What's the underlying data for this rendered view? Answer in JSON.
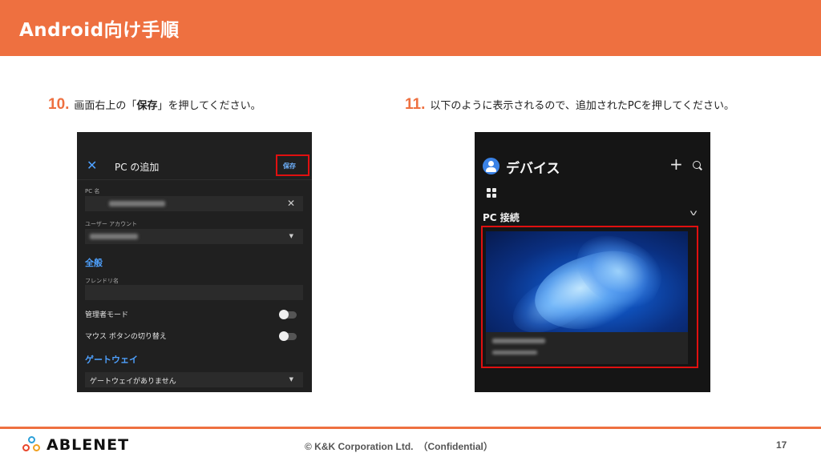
{
  "header": {
    "title": "Android向け手順"
  },
  "step10": {
    "number": "10.",
    "text_pre": "画面右上の「",
    "text_bold": "保存",
    "text_post": "」を押してください。"
  },
  "step11": {
    "number": "11.",
    "text": "以下のように表示されるので、追加されたPCを押してください。"
  },
  "screen1": {
    "close_glyph": "✕",
    "title": "PC の追加",
    "save_label": "保存",
    "pc_name_label": "PC 名",
    "clear_glyph": "✕",
    "user_account_label": "ユーザー アカウント",
    "dropdown_glyph": "▼",
    "section_general": "全般",
    "friendly_name_label": "フレンドリ名",
    "admin_mode_label": "管理者モード",
    "swap_mouse_label": "マウス ボタンの切り替え",
    "section_gateway": "ゲートウェイ",
    "gateway_value": "ゲートウェイがありません"
  },
  "screen2": {
    "title": "デバイス",
    "add_glyph": "+",
    "section_pc": "PC 接続",
    "chevron_glyph": "v"
  },
  "footer": {
    "logo_text": "ABLENET",
    "copyright": "© K&K Corporation Ltd.　（Confidential）",
    "page_number": "17"
  },
  "colors": {
    "accent": "#ee7040",
    "highlight_border": "#e01010",
    "link_blue": "#4ea1ff"
  }
}
